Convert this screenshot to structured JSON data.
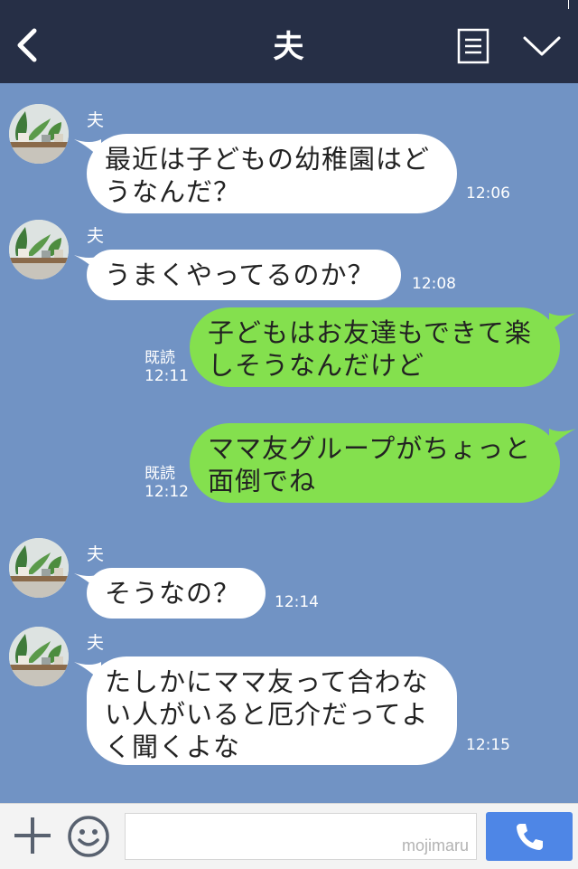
{
  "header": {
    "title": "夫",
    "back_icon": "back-chevron-icon",
    "menu_icon": "document-menu-icon",
    "expand_icon": "chevron-down-icon",
    "background": "#262f46"
  },
  "chat_background": "#7193c4",
  "messages": [
    {
      "side": "incoming",
      "sender": "夫",
      "lines": [
        "最近は子どもの幼稚園はど",
        "うなんだ？"
      ],
      "time": "12:06"
    },
    {
      "side": "incoming",
      "sender": "夫",
      "lines": [
        "うまくやってるのか？"
      ],
      "time": "12:08"
    },
    {
      "side": "outgoing",
      "lines": [
        "子どもはお友達もできて楽",
        "しそうなんだけど"
      ],
      "read": "既読",
      "time": "12:11"
    },
    {
      "side": "outgoing",
      "lines": [
        "ママ友グループがちょっと",
        "面倒でね"
      ],
      "read": "既読",
      "time": "12:12"
    },
    {
      "side": "incoming",
      "sender": "夫",
      "lines": [
        "そうなの？"
      ],
      "time": "12:14"
    },
    {
      "side": "incoming",
      "sender": "夫",
      "lines": [
        "たしかにママ友って合わな",
        "い人がいると厄介だってよ",
        "く聞くよな"
      ],
      "time": "12:15"
    }
  ],
  "colors": {
    "incoming_bubble": "#ffffff",
    "outgoing_bubble": "#84e04e",
    "call_button": "#4e86e6"
  },
  "input_bar": {
    "plus_icon": "plus-icon",
    "emoji_icon": "smiley-icon",
    "text_value": "",
    "watermark": "mojimaru",
    "call_icon": "phone-icon"
  }
}
